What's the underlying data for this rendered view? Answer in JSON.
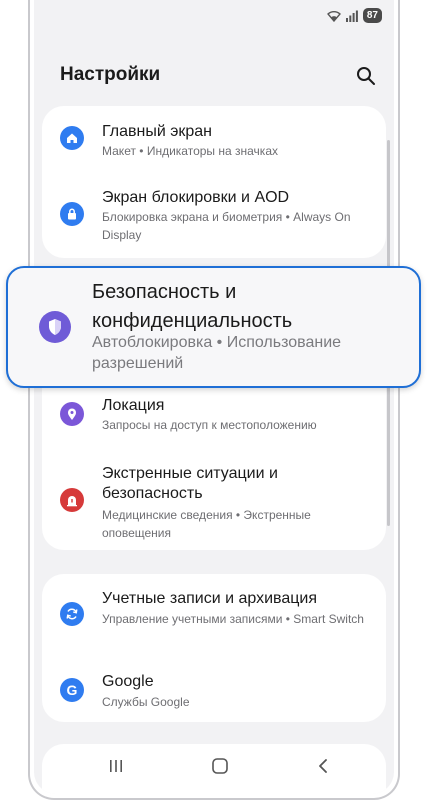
{
  "status": {
    "battery": "87",
    "wifi_icon": "wifi-icon",
    "signal_icon": "signal-icon"
  },
  "header": {
    "title": "Настройки",
    "search_icon": "search-icon"
  },
  "cards": {
    "home": {
      "title": "Главный экран",
      "sub": "Макет  •  Индикаторы на значках"
    },
    "lock": {
      "title": "Экран блокировки и AOD",
      "sub": "Блокировка экрана и биометрия  •  Always On Display"
    },
    "location": {
      "title": "Локация",
      "sub": "Запросы на доступ к местоположению"
    },
    "emergency": {
      "title": "Экстренные ситуации и безопасность",
      "sub": "Медицинские сведения  •  Экстренные оповещения"
    },
    "accounts": {
      "title": "Учетные записи и архивация",
      "sub": "Управление учетными записями  •  Smart Switch"
    },
    "google": {
      "title": "Google",
      "sub": "Службы Google"
    }
  },
  "highlight": {
    "title": "Безопасность и конфиденциальность",
    "sub": "Автоблокировка  •  Использование разрешений"
  },
  "colors": {
    "accent": "#1f6fd6",
    "home_icon": "#2f7cf0",
    "lock_icon": "#2f7cf0",
    "security_icon": "#6f5bd7",
    "location_icon": "#7b57d8",
    "emergency_icon": "#d63a3a",
    "accounts_icon": "#2f7cf0",
    "google_icon": "#2f7cf0"
  },
  "nav": {
    "recents_icon": "recents-icon",
    "home_icon": "home-nav-icon",
    "back_icon": "back-icon"
  }
}
